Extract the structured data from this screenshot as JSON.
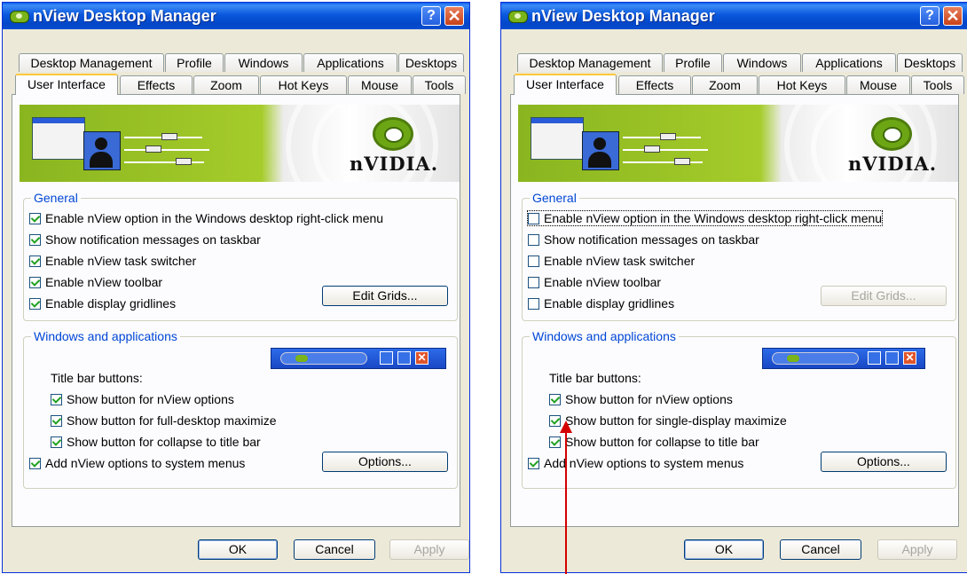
{
  "windows": [
    {
      "title": "nView Desktop Manager",
      "help_glyph": "?",
      "close_glyph": "✕",
      "tabs_row1": [
        "Desktop Management",
        "Profile",
        "Windows",
        "Applications",
        "Desktops"
      ],
      "tabs_row2": [
        "User Interface",
        "Effects",
        "Zoom",
        "Hot Keys",
        "Mouse",
        "Tools"
      ],
      "active_tab": "User Interface",
      "banner_brand": "nVIDIA.",
      "general": {
        "legend": "General",
        "items": [
          {
            "label": "Enable nView option in the Windows desktop right-click menu",
            "checked": true
          },
          {
            "label": "Show notification messages on taskbar",
            "checked": true
          },
          {
            "label": "Enable nView task switcher",
            "checked": true
          },
          {
            "label": "Enable nView toolbar",
            "checked": true
          },
          {
            "label": "Enable display gridlines",
            "checked": true
          }
        ],
        "edit_grids": "Edit Grids...",
        "edit_grids_enabled": true
      },
      "windows_apps": {
        "legend": "Windows and applications",
        "title_bar_buttons": "Title bar buttons:",
        "items": [
          {
            "label": "Show button for nView options",
            "checked": true
          },
          {
            "label": "Show button for full-desktop maximize",
            "checked": true
          },
          {
            "label": "Show button for collapse to title bar",
            "checked": true
          }
        ],
        "system_menus": {
          "label": "Add nView options to system menus",
          "checked": true
        },
        "options": "Options..."
      },
      "footer": {
        "ok": "OK",
        "cancel": "Cancel",
        "apply": "Apply"
      }
    },
    {
      "title": "nView Desktop Manager",
      "help_glyph": "?",
      "close_glyph": "✕",
      "tabs_row1": [
        "Desktop Management",
        "Profile",
        "Windows",
        "Applications",
        "Desktops"
      ],
      "tabs_row2": [
        "User Interface",
        "Effects",
        "Zoom",
        "Hot Keys",
        "Mouse",
        "Tools"
      ],
      "active_tab": "User Interface",
      "banner_brand": "nVIDIA.",
      "general": {
        "legend": "General",
        "items": [
          {
            "label": "Enable nView option in the Windows desktop right-click menu",
            "checked": false
          },
          {
            "label": "Show notification messages on taskbar",
            "checked": false
          },
          {
            "label": "Enable nView task switcher",
            "checked": false
          },
          {
            "label": "Enable nView toolbar",
            "checked": false
          },
          {
            "label": "Enable display gridlines",
            "checked": false
          }
        ],
        "edit_grids": "Edit Grids...",
        "edit_grids_enabled": false
      },
      "windows_apps": {
        "legend": "Windows and applications",
        "title_bar_buttons": "Title bar buttons:",
        "items": [
          {
            "label": "Show button for nView options",
            "checked": true
          },
          {
            "label": "Show button for single-display maximize",
            "checked": true
          },
          {
            "label": "Show button for collapse to title bar",
            "checked": true
          }
        ],
        "system_menus": {
          "label": "Add nView options to system menus",
          "checked": true
        },
        "options": "Options..."
      },
      "footer": {
        "ok": "OK",
        "cancel": "Cancel",
        "apply": "Apply"
      }
    }
  ],
  "colors": {
    "annotation_arrow": "#d40000",
    "accent": "#0046d5"
  }
}
